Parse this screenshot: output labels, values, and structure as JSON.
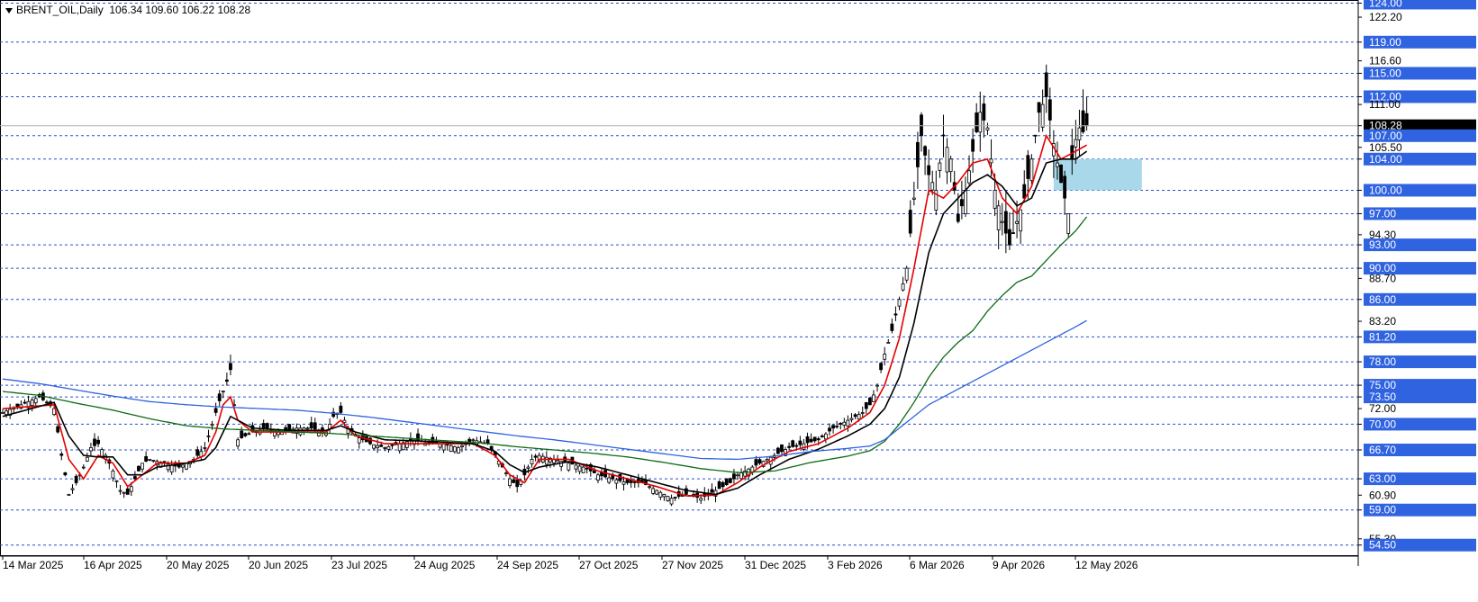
{
  "header": {
    "symbol": "BRENT_OIL,Daily",
    "ohlc": "106.34 109.60 106.22 108.28"
  },
  "colors": {
    "background": "#ffffff",
    "grid_dashed": "#2a4fc6",
    "bull_candle": "#000000",
    "bear_candle": "#000000",
    "ma_red": "#e60000",
    "ma_black": "#000000",
    "ma_green": "#0b6b12",
    "ma_blue": "#2f63e0",
    "label_bg": "#2f63e0",
    "current_price_bg": "#000000",
    "zone_fill": "#a8d8ea"
  },
  "chart_data": {
    "type": "candlestick",
    "ylim": [
      53.2,
      124.4
    ],
    "price_labels": [
      "124.00",
      "122.20",
      "119.00",
      "116.60",
      "115.00",
      "112.00",
      "111.00",
      "108.28",
      "107.00",
      "105.50",
      "104.00",
      "100.00",
      "97.00",
      "94.30",
      "93.00",
      "90.00",
      "88.70",
      "86.00",
      "83.20",
      "81.20",
      "78.00",
      "75.00",
      "73.50",
      "72.00",
      "70.00",
      "66.70",
      "63.00",
      "60.90",
      "59.00",
      "55.30",
      "54.50"
    ],
    "highlighted_levels": [
      124.0,
      119.0,
      115.0,
      112.0,
      107.0,
      104.0,
      100.0,
      97.0,
      93.0,
      90.0,
      86.0,
      81.2,
      78.0,
      75.0,
      73.5,
      70.0,
      66.7,
      63.0,
      59.0,
      54.5
    ],
    "plain_levels": [
      122.2,
      116.6,
      111.0,
      105.5,
      94.3,
      88.7,
      83.2,
      72.0,
      60.9,
      55.3
    ],
    "current_price": 108.28,
    "x_labels": [
      "14 Mar 2025",
      "16 Apr 2025",
      "20 May 2025",
      "20 Jun 2025",
      "23 Jul 2025",
      "24 Aug 2025",
      "24 Sep 2025",
      "27 Oct 2025",
      "27 Nov 2025",
      "31 Dec 2025",
      "3 Feb 2026",
      "6 Mar 2026",
      "9 Apr 2026",
      "12 May 2026"
    ],
    "zone": {
      "from_label": "30 Apr 2026",
      "to_label": "3 Jun 2026",
      "low": 100.0,
      "high": 104.0
    },
    "close_path": [
      [
        0,
        71.5
      ],
      [
        5,
        72.5
      ],
      [
        10,
        73.5
      ],
      [
        14,
        72.0
      ],
      [
        16,
        66.0
      ],
      [
        18,
        61.0
      ],
      [
        20,
        62.5
      ],
      [
        22,
        64.5
      ],
      [
        24,
        67.0
      ],
      [
        26,
        67.5
      ],
      [
        28,
        66.0
      ],
      [
        30,
        64.0
      ],
      [
        32,
        61.5
      ],
      [
        34,
        61.0
      ],
      [
        36,
        63.0
      ],
      [
        38,
        65.0
      ],
      [
        40,
        65.5
      ],
      [
        44,
        65.0
      ],
      [
        48,
        64.5
      ],
      [
        52,
        65.5
      ],
      [
        55,
        67.0
      ],
      [
        57,
        70.0
      ],
      [
        59,
        73.0
      ],
      [
        61,
        75.5
      ],
      [
        62,
        77.0
      ],
      [
        63,
        72.5
      ],
      [
        64,
        68.0
      ],
      [
        66,
        68.5
      ],
      [
        68,
        69.0
      ],
      [
        72,
        69.5
      ],
      [
        76,
        69.0
      ],
      [
        80,
        69.5
      ],
      [
        84,
        69.5
      ],
      [
        88,
        69.0
      ],
      [
        90,
        71.0
      ],
      [
        92,
        71.5
      ],
      [
        94,
        69.5
      ],
      [
        96,
        68.5
      ],
      [
        100,
        67.5
      ],
      [
        104,
        67.0
      ],
      [
        108,
        67.5
      ],
      [
        112,
        68.0
      ],
      [
        116,
        67.5
      ],
      [
        120,
        67.5
      ],
      [
        124,
        67.0
      ],
      [
        128,
        68.0
      ],
      [
        132,
        67.5
      ],
      [
        134,
        66.0
      ],
      [
        136,
        64.5
      ],
      [
        138,
        63.0
      ],
      [
        140,
        62.0
      ],
      [
        142,
        63.5
      ],
      [
        144,
        65.5
      ],
      [
        146,
        66.0
      ],
      [
        150,
        65.5
      ],
      [
        154,
        65.0
      ],
      [
        158,
        64.5
      ],
      [
        162,
        63.5
      ],
      [
        166,
        63.0
      ],
      [
        170,
        62.5
      ],
      [
        174,
        62.5
      ],
      [
        178,
        61.5
      ],
      [
        182,
        60.5
      ],
      [
        186,
        61.0
      ],
      [
        190,
        60.5
      ],
      [
        194,
        61.5
      ],
      [
        198,
        62.5
      ],
      [
        200,
        63.5
      ],
      [
        202,
        64.0
      ],
      [
        206,
        65.0
      ],
      [
        210,
        66.0
      ],
      [
        214,
        67.0
      ],
      [
        218,
        67.5
      ],
      [
        222,
        68.0
      ],
      [
        226,
        69.5
      ],
      [
        230,
        70.5
      ],
      [
        234,
        71.5
      ],
      [
        236,
        72.5
      ],
      [
        238,
        75.0
      ],
      [
        240,
        79.0
      ],
      [
        242,
        82.0
      ],
      [
        244,
        86.0
      ],
      [
        246,
        90.0
      ],
      [
        248,
        99.0
      ],
      [
        250,
        107.0
      ],
      [
        252,
        102.0
      ],
      [
        254,
        100.0
      ],
      [
        256,
        107.0
      ],
      [
        258,
        104.0
      ],
      [
        260,
        96.0
      ],
      [
        262,
        100.0
      ],
      [
        264,
        105.0
      ],
      [
        266,
        110.0
      ],
      [
        268,
        108.0
      ],
      [
        270,
        100.0
      ],
      [
        272,
        96.0
      ],
      [
        274,
        93.0
      ],
      [
        276,
        96.0
      ],
      [
        278,
        99.0
      ],
      [
        280,
        104.0
      ],
      [
        282,
        110.0
      ],
      [
        284,
        112.0
      ],
      [
        286,
        106.0
      ],
      [
        288,
        101.0
      ],
      [
        290,
        97.0
      ],
      [
        291,
        104.0
      ],
      [
        292,
        106.5
      ],
      [
        293,
        108.0
      ],
      [
        294,
        107.5
      ],
      [
        295,
        108.28
      ]
    ],
    "series": [
      {
        "name": "",
        "color": "#e60000",
        "points": [
          [
            0,
            72.0
          ],
          [
            14,
            72.5
          ],
          [
            18,
            65.5
          ],
          [
            22,
            63.0
          ],
          [
            26,
            66.0
          ],
          [
            30,
            65.0
          ],
          [
            34,
            62.0
          ],
          [
            38,
            63.5
          ],
          [
            42,
            65.0
          ],
          [
            50,
            65.0
          ],
          [
            55,
            66.0
          ],
          [
            58,
            69.0
          ],
          [
            60,
            72.5
          ],
          [
            62,
            73.5
          ],
          [
            64,
            70.5
          ],
          [
            68,
            69.0
          ],
          [
            78,
            69.0
          ],
          [
            88,
            69.0
          ],
          [
            92,
            70.5
          ],
          [
            96,
            68.5
          ],
          [
            104,
            67.5
          ],
          [
            116,
            67.5
          ],
          [
            128,
            67.5
          ],
          [
            134,
            66.0
          ],
          [
            138,
            63.5
          ],
          [
            142,
            62.5
          ],
          [
            146,
            65.5
          ],
          [
            154,
            65.5
          ],
          [
            162,
            64.0
          ],
          [
            170,
            63.0
          ],
          [
            178,
            62.0
          ],
          [
            186,
            60.8
          ],
          [
            194,
            60.9
          ],
          [
            200,
            62.5
          ],
          [
            206,
            64.5
          ],
          [
            214,
            66.5
          ],
          [
            222,
            67.5
          ],
          [
            230,
            69.5
          ],
          [
            236,
            71.5
          ],
          [
            240,
            75.0
          ],
          [
            244,
            81.0
          ],
          [
            248,
            90.0
          ],
          [
            252,
            100.0
          ],
          [
            256,
            99.0
          ],
          [
            260,
            101.0
          ],
          [
            264,
            103.5
          ],
          [
            268,
            104.0
          ],
          [
            272,
            99.0
          ],
          [
            276,
            97.0
          ],
          [
            280,
            100.5
          ],
          [
            284,
            107.0
          ],
          [
            288,
            104.0
          ],
          [
            292,
            105.0
          ],
          [
            295,
            105.8
          ]
        ]
      },
      {
        "name": "",
        "color": "#000000",
        "points": [
          [
            0,
            71.0
          ],
          [
            14,
            72.8
          ],
          [
            18,
            68.5
          ],
          [
            22,
            66.0
          ],
          [
            26,
            65.8
          ],
          [
            30,
            65.8
          ],
          [
            34,
            63.5
          ],
          [
            38,
            63.5
          ],
          [
            42,
            64.5
          ],
          [
            50,
            65.0
          ],
          [
            55,
            65.5
          ],
          [
            58,
            67.0
          ],
          [
            60,
            69.0
          ],
          [
            62,
            71.0
          ],
          [
            64,
            70.5
          ],
          [
            68,
            69.5
          ],
          [
            78,
            69.2
          ],
          [
            88,
            69.2
          ],
          [
            92,
            69.8
          ],
          [
            96,
            69.0
          ],
          [
            104,
            68.0
          ],
          [
            116,
            67.8
          ],
          [
            128,
            67.5
          ],
          [
            134,
            66.5
          ],
          [
            138,
            64.8
          ],
          [
            142,
            63.8
          ],
          [
            146,
            64.5
          ],
          [
            154,
            65.2
          ],
          [
            162,
            64.5
          ],
          [
            170,
            63.5
          ],
          [
            178,
            62.5
          ],
          [
            186,
            61.5
          ],
          [
            194,
            61.0
          ],
          [
            200,
            61.8
          ],
          [
            206,
            63.5
          ],
          [
            214,
            65.5
          ],
          [
            222,
            66.8
          ],
          [
            230,
            68.5
          ],
          [
            236,
            70.0
          ],
          [
            240,
            72.0
          ],
          [
            244,
            76.0
          ],
          [
            248,
            83.0
          ],
          [
            252,
            92.0
          ],
          [
            256,
            97.0
          ],
          [
            260,
            99.0
          ],
          [
            264,
            101.0
          ],
          [
            268,
            102.0
          ],
          [
            272,
            100.5
          ],
          [
            276,
            98.0
          ],
          [
            280,
            99.0
          ],
          [
            284,
            103.5
          ],
          [
            288,
            104.0
          ],
          [
            292,
            104.0
          ],
          [
            295,
            105.0
          ]
        ]
      },
      {
        "name": "",
        "color": "#0b6b12",
        "points": [
          [
            0,
            74.2
          ],
          [
            10,
            73.7
          ],
          [
            20,
            72.7
          ],
          [
            30,
            71.8
          ],
          [
            40,
            70.7
          ],
          [
            50,
            69.8
          ],
          [
            60,
            69.4
          ],
          [
            70,
            69.2
          ],
          [
            80,
            69.0
          ],
          [
            90,
            68.8
          ],
          [
            100,
            68.5
          ],
          [
            110,
            68.2
          ],
          [
            120,
            67.9
          ],
          [
            130,
            67.6
          ],
          [
            140,
            67.1
          ],
          [
            150,
            66.7
          ],
          [
            160,
            66.3
          ],
          [
            170,
            65.8
          ],
          [
            180,
            65.1
          ],
          [
            190,
            64.3
          ],
          [
            200,
            63.8
          ],
          [
            210,
            64.0
          ],
          [
            220,
            65.1
          ],
          [
            230,
            65.9
          ],
          [
            236,
            66.6
          ],
          [
            240,
            67.8
          ],
          [
            244,
            70.0
          ],
          [
            248,
            72.8
          ],
          [
            252,
            76.0
          ],
          [
            256,
            78.6
          ],
          [
            260,
            80.5
          ],
          [
            264,
            82.0
          ],
          [
            268,
            84.5
          ],
          [
            272,
            86.5
          ],
          [
            276,
            88.2
          ],
          [
            280,
            89.0
          ],
          [
            284,
            91.0
          ],
          [
            288,
            93.0
          ],
          [
            292,
            94.8
          ],
          [
            295,
            96.6
          ]
        ]
      },
      {
        "name": "",
        "color": "#2f63e0",
        "points": [
          [
            0,
            75.8
          ],
          [
            10,
            75.2
          ],
          [
            20,
            74.4
          ],
          [
            30,
            73.6
          ],
          [
            40,
            72.9
          ],
          [
            50,
            72.5
          ],
          [
            60,
            72.2
          ],
          [
            70,
            72.0
          ],
          [
            80,
            71.8
          ],
          [
            90,
            71.4
          ],
          [
            100,
            70.9
          ],
          [
            110,
            70.3
          ],
          [
            120,
            69.7
          ],
          [
            130,
            69.1
          ],
          [
            140,
            68.5
          ],
          [
            150,
            68.0
          ],
          [
            160,
            67.4
          ],
          [
            170,
            66.8
          ],
          [
            180,
            66.2
          ],
          [
            190,
            65.6
          ],
          [
            200,
            65.5
          ],
          [
            210,
            65.9
          ],
          [
            220,
            66.5
          ],
          [
            230,
            66.9
          ],
          [
            236,
            67.2
          ],
          [
            240,
            68.0
          ],
          [
            244,
            69.5
          ],
          [
            248,
            71.0
          ],
          [
            252,
            72.5
          ],
          [
            256,
            73.5
          ],
          [
            260,
            74.5
          ],
          [
            264,
            75.5
          ],
          [
            268,
            76.5
          ],
          [
            272,
            77.5
          ],
          [
            276,
            78.5
          ],
          [
            280,
            79.5
          ],
          [
            284,
            80.5
          ],
          [
            288,
            81.5
          ],
          [
            292,
            82.5
          ],
          [
            295,
            83.3
          ]
        ]
      }
    ]
  }
}
